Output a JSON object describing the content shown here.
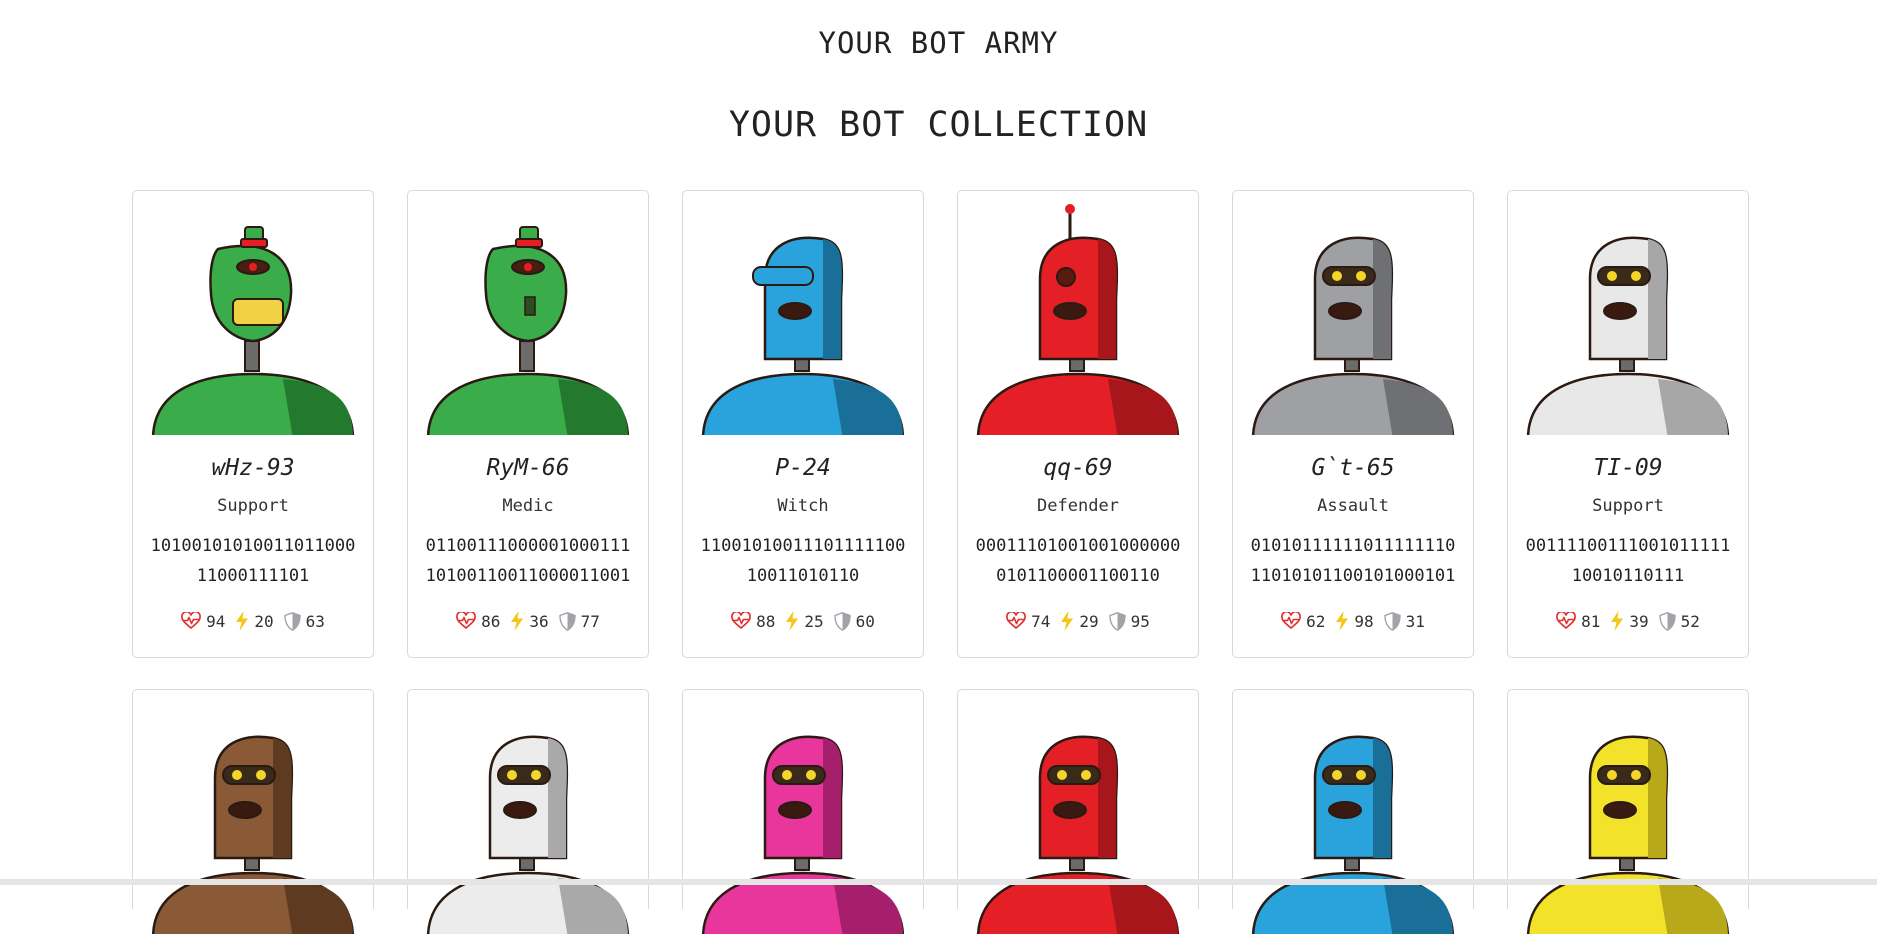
{
  "header": {
    "army_title": "YOUR BOT ARMY",
    "collection_title": "YOUR BOT COLLECTION"
  },
  "bots": [
    {
      "name": "wHz-93",
      "bot_class": "Support",
      "catchphrase": "1010010101001101100011000111101",
      "health": "94",
      "damage": "20",
      "armor": "63",
      "color": "#3aad4a",
      "dark": "#237a2f",
      "style": "green-grin"
    },
    {
      "name": "RyM-66",
      "bot_class": "Medic",
      "catchphrase": "0110011100000100011110100110011000011001",
      "health": "86",
      "damage": "36",
      "armor": "77",
      "color": "#3aad4a",
      "dark": "#237a2f",
      "style": "green-thin"
    },
    {
      "name": "P-24",
      "bot_class": "Witch",
      "catchphrase": "1100101001110111110010011010110",
      "health": "88",
      "damage": "25",
      "armor": "60",
      "color": "#2aa3dc",
      "dark": "#1a6f99",
      "style": "blue"
    },
    {
      "name": "qq-69",
      "bot_class": "Defender",
      "catchphrase": "000111010010010000000101100001100110",
      "health": "74",
      "damage": "29",
      "armor": "95",
      "color": "#e42026",
      "dark": "#a6161b",
      "style": "red"
    },
    {
      "name": "G`t-65",
      "bot_class": "Assault",
      "catchphrase": "0101011111101111111011010101100101000101",
      "health": "62",
      "damage": "98",
      "armor": "31",
      "color": "#9ea0a3",
      "dark": "#6e7073",
      "style": "grey"
    },
    {
      "name": "TI-09",
      "bot_class": "Support",
      "catchphrase": "0011110011100101111110010110111",
      "health": "81",
      "damage": "39",
      "armor": "52",
      "color": "#e8e8e8",
      "dark": "#a7a7a7",
      "style": "white"
    }
  ],
  "bots_row2": [
    {
      "color": "#8a5a36",
      "dark": "#5d3a20"
    },
    {
      "color": "#ececec",
      "dark": "#a9a9a9"
    },
    {
      "color": "#e8369c",
      "dark": "#a61f6c"
    },
    {
      "color": "#e42026",
      "dark": "#a6161b"
    },
    {
      "color": "#2aa3dc",
      "dark": "#1a6f99"
    },
    {
      "color": "#f2e229",
      "dark": "#b8a91b"
    }
  ],
  "icons": {
    "health": "heart-pulse-icon",
    "damage": "lightning-icon",
    "armor": "shield-icon"
  },
  "stat_colors": {
    "health": "#e03131",
    "damage": "#f5c518",
    "armor": "#a0a4a8"
  }
}
